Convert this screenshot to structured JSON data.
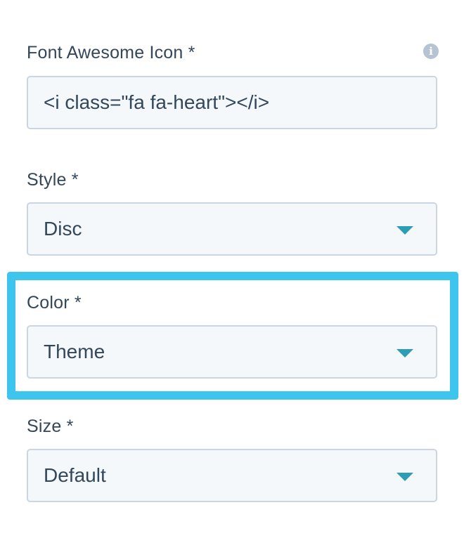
{
  "fields": {
    "icon": {
      "label": "Font Awesome Icon *",
      "value": "<i class=\"fa fa-heart\"></i>",
      "info_icon": "info-icon"
    },
    "style": {
      "label": "Style *",
      "selected": "Disc"
    },
    "color": {
      "label": "Color *",
      "selected": "Theme"
    },
    "size": {
      "label": "Size *",
      "selected": "Default"
    }
  },
  "colors": {
    "text": "#33475b",
    "input_bg": "#f5f8fa",
    "input_border": "#cbd6e2",
    "caret": "#2d9db5",
    "highlight": "#3dc5ee",
    "info_icon": "#b6c3d2"
  }
}
